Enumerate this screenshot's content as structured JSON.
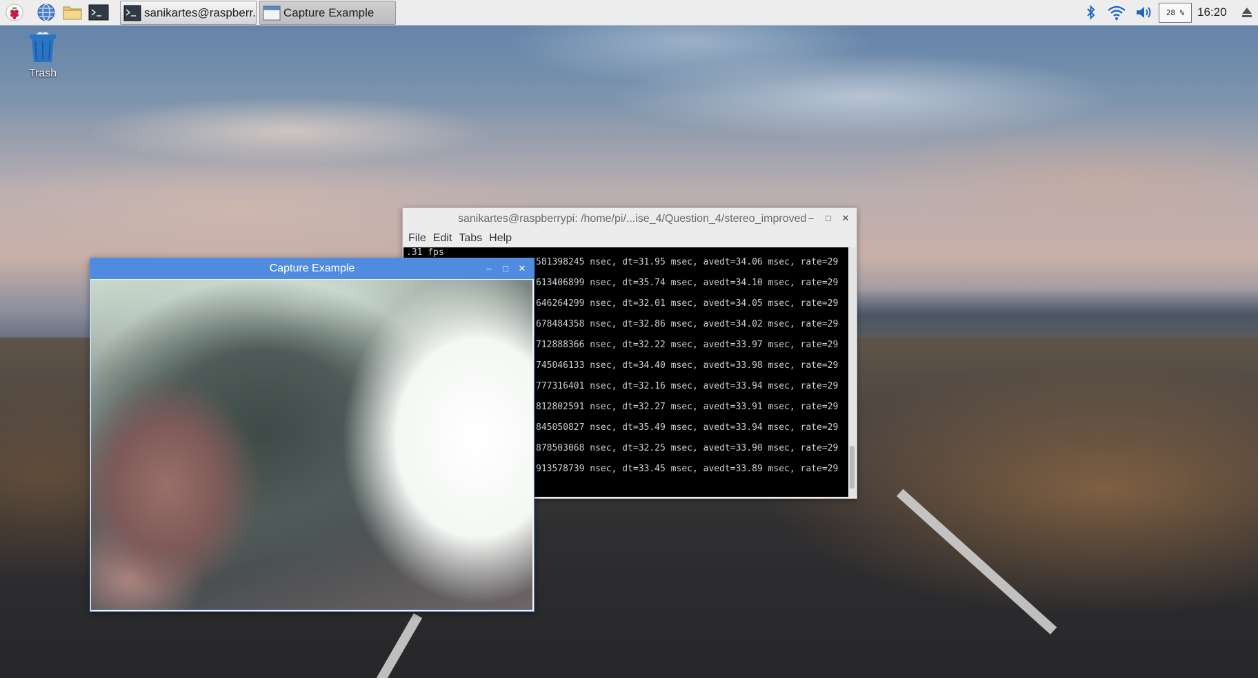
{
  "taskbar": {
    "launchers": [
      "raspberry-menu-icon",
      "web-browser-icon",
      "file-manager-icon",
      "terminal-icon"
    ],
    "tasks": [
      {
        "label": "sanikartes@raspberr...",
        "icon": "terminal-icon",
        "active": false
      },
      {
        "label": "Capture Example",
        "icon": "window-icon",
        "active": true
      }
    ],
    "tray": {
      "bluetooth": "bluetooth-icon",
      "wifi": "wifi-icon",
      "volume": "volume-icon",
      "cpu": "28 %",
      "clock": "16:20",
      "eject": "eject-icon"
    }
  },
  "desktop": {
    "trash_label": "Trash"
  },
  "terminal": {
    "title": "sanikartes@raspberrypi: /home/pi/...ise_4/Question_4/stereo_improved",
    "menu": [
      "File",
      "Edit",
      "Tabs",
      "Help"
    ],
    "first_line": ".31 fps",
    "lines": [
      "581398245 nsec, dt=31.95 msec, avedt=34.06 msec, rate=29",
      "613406899 nsec, dt=35.74 msec, avedt=34.10 msec, rate=29",
      "646264299 nsec, dt=32.01 msec, avedt=34.05 msec, rate=29",
      "678484358 nsec, dt=32.86 msec, avedt=34.02 msec, rate=29",
      "712888366 nsec, dt=32.22 msec, avedt=33.97 msec, rate=29",
      "745046133 nsec, dt=34.40 msec, avedt=33.98 msec, rate=29",
      "777316401 nsec, dt=32.16 msec, avedt=33.94 msec, rate=29",
      "812802591 nsec, dt=32.27 msec, avedt=33.91 msec, rate=29",
      "845050827 nsec, dt=35.49 msec, avedt=33.94 msec, rate=29",
      "878503068 nsec, dt=32.25 msec, avedt=33.90 msec, rate=29",
      "913578739 nsec, dt=33.45 msec, avedt=33.89 msec, rate=29"
    ]
  },
  "capture": {
    "title": "Capture Example"
  },
  "colors": {
    "taskbar_bg": "#ededed",
    "capture_title_bg": "#4f8ce0",
    "terminal_bg": "#000000",
    "terminal_fg": "#cfcfcf"
  }
}
